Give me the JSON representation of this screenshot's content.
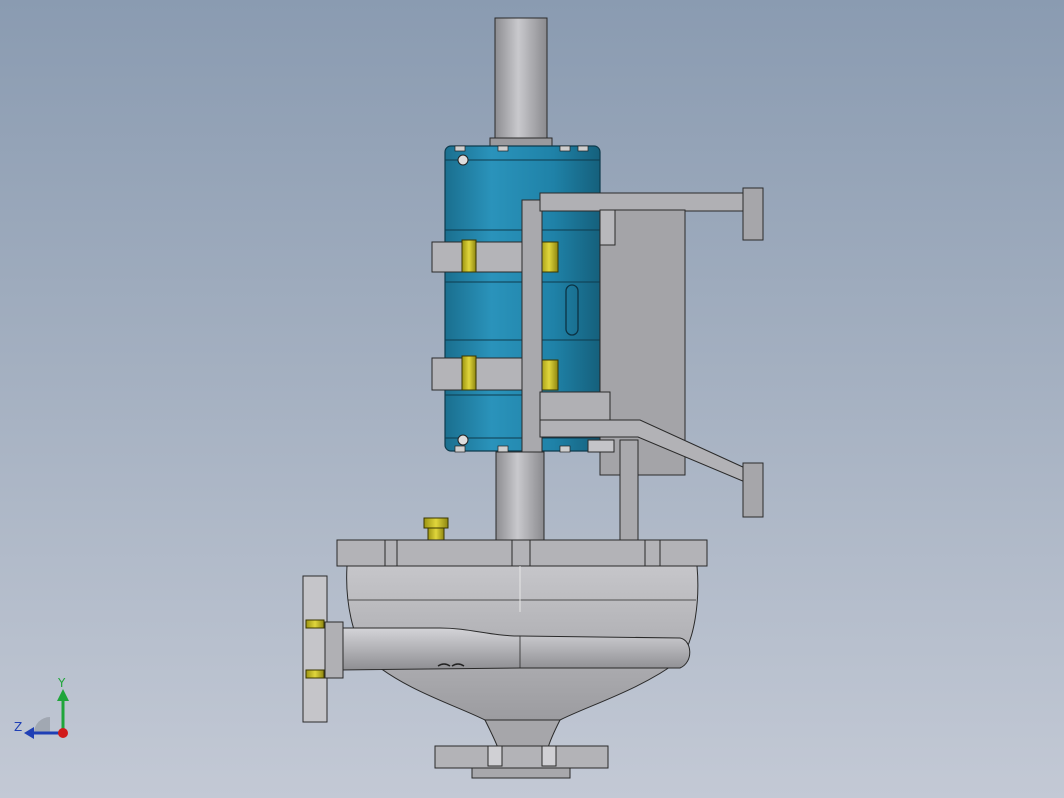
{
  "viewport": {
    "background_top": "#8a9bb1",
    "background_bottom": "#c3c9d5"
  },
  "model": {
    "motor_color": "#1e7fa3",
    "metal_color": "#b9b9bd",
    "bolt_color": "#c8be28",
    "bracket_color": "#a9a9ad"
  },
  "triad": {
    "y_label": "Y",
    "z_label": "Z",
    "y_axis_color": "#1fa53a",
    "z_axis_color": "#1f3fb5",
    "x_axis_color": "#d11a1a"
  }
}
